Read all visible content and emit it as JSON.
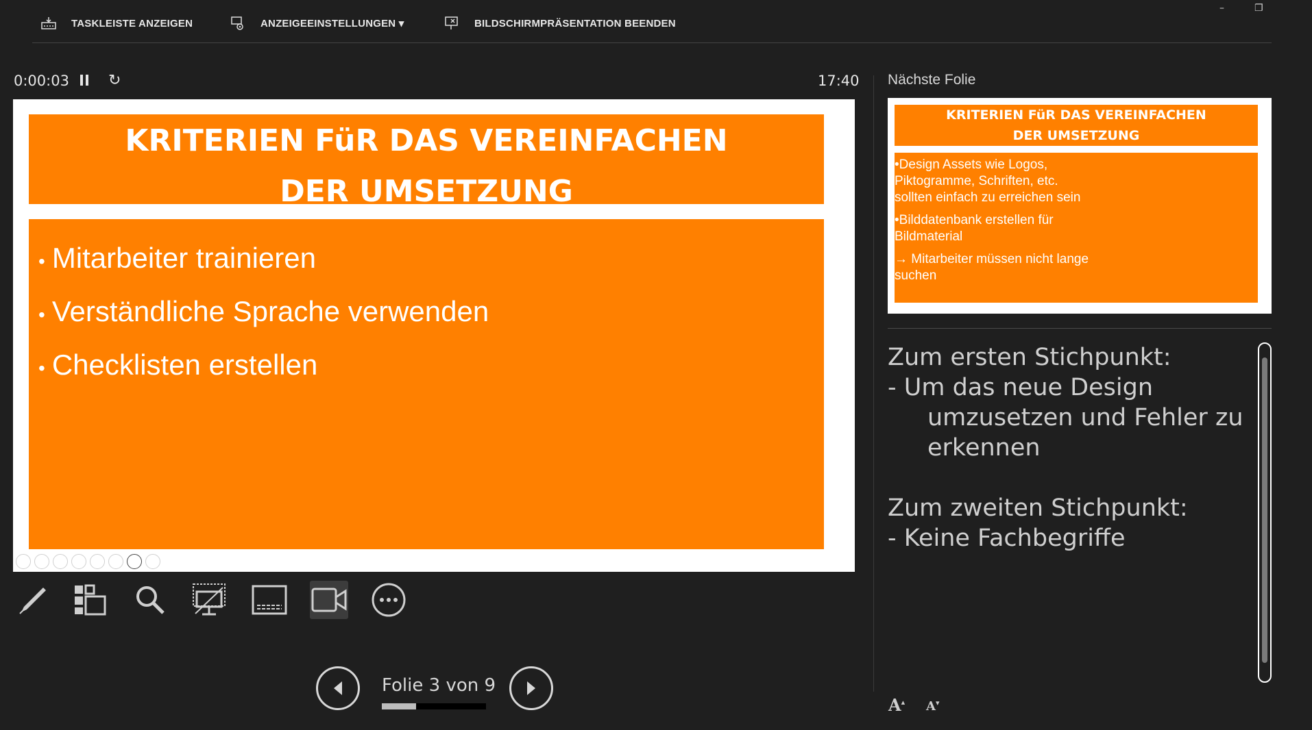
{
  "toolbar": {
    "show_taskbar": "TASKLEISTE ANZEIGEN",
    "display_settings": "ANZEIGEEINSTELLUNGEN ▾",
    "end_slideshow": "BILDSCHIRMPRÄSENTATION BEENDEN"
  },
  "window_controls": {
    "minimize": "–",
    "restore": "❐"
  },
  "timer": {
    "elapsed": "0:00:03",
    "clock": "17:40"
  },
  "current_slide": {
    "title_line1": "KRITERIEN FüR DAS VEREINFACHEN",
    "title_line2": "DER UMSETZUNG",
    "bullets": [
      "Mitarbeiter trainieren",
      "Verständliche Sprache verwenden",
      "Checklisten erstellen"
    ]
  },
  "navigation": {
    "counter": "Folie 3 von 9",
    "progress": 0.33
  },
  "next_slide": {
    "label": "Nächste Folie",
    "title_line1": "KRITERIEN FüR DAS VEREINFACHEN",
    "title_line2": "DER UMSETZUNG",
    "paragraphs": [
      [
        "•Design Assets wie Logos,",
        "Piktogramme, Schriften, etc.",
        "sollten einfach zu erreichen sein"
      ],
      [
        "•Bilddatenbank erstellen für",
        "Bildmaterial"
      ],
      [
        "→ Mitarbeiter müssen nicht lange",
        "suchen"
      ]
    ]
  },
  "notes": {
    "p1_head": "Zum ersten Stichpunkt:",
    "p1_line1": "- Um das neue Design",
    "p1_line2": "umzusetzen und Fehler zu",
    "p1_line3": "erkennen",
    "p2_head": "Zum zweiten Stichpunkt:",
    "p2_line1": "- Keine Fachbegriffe"
  },
  "font_controls": {
    "increase": "A",
    "decrease": "A"
  },
  "colors": {
    "accent": "#ff8000",
    "background": "#1f1f1f"
  },
  "icons": [
    "taskbar-icon",
    "display-settings-icon",
    "end-show-icon",
    "pause-icon",
    "restart-icon",
    "pen-icon",
    "slides-grid-icon",
    "zoom-icon",
    "black-screen-icon",
    "subtitles-icon",
    "camera-icon",
    "more-icon",
    "prev-icon",
    "next-icon"
  ]
}
